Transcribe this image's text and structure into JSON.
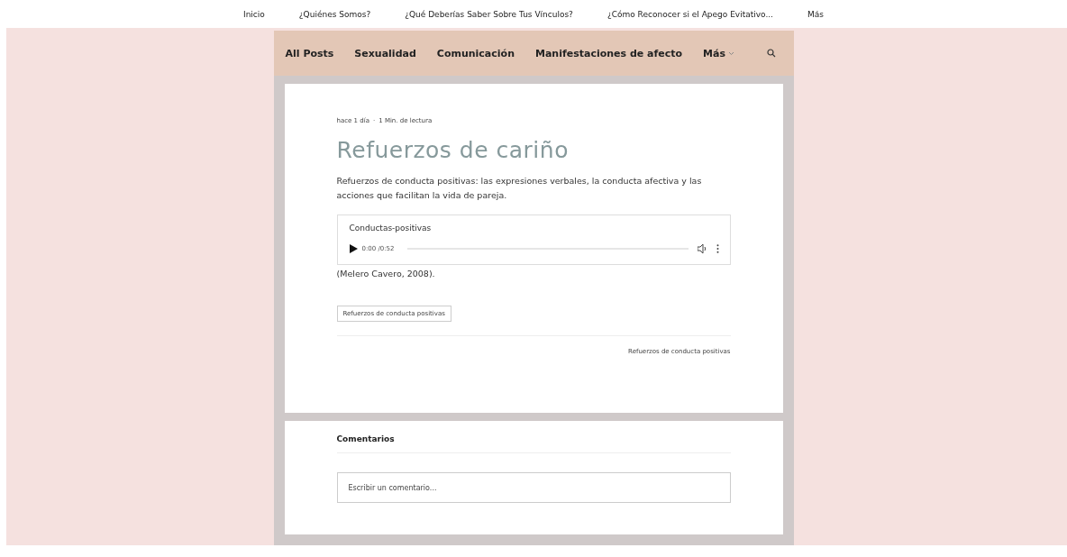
{
  "site_nav": [
    {
      "label": "Inicio"
    },
    {
      "label": "¿Quiénes Somos?"
    },
    {
      "label": "¿Qué Deberías Saber Sobre Tus Vínculos?"
    },
    {
      "label": "¿Cómo Reconocer si el Apego Evitativo..."
    },
    {
      "label": "Más"
    }
  ],
  "category_nav": {
    "items": [
      {
        "label": "All Posts",
        "kind": "link"
      },
      {
        "label": "Sexualidad",
        "kind": "link"
      },
      {
        "label": "Comunicación",
        "kind": "link"
      },
      {
        "label": "Manifestaciones de afecto",
        "kind": "link"
      },
      {
        "label": "Más",
        "kind": "dropdown"
      }
    ]
  },
  "post": {
    "date": "hace 1 día",
    "separator": "·",
    "read_time": "1 Min. de lectura",
    "title": "Refuerzos de cariño",
    "intro": "Refuerzos de conducta positivas: las expresiones verbales, la conducta afectiva y las acciones que facilitan la vida de pareja.",
    "audio": {
      "title": "Conductas-positivas",
      "time": "0:00 /0:52"
    },
    "citation": "(Melero Cavero, 2008).",
    "tags": [
      "Refuerzos de conducta positivas"
    ],
    "category_link": "Refuerzos de conducta positivas"
  },
  "comments": {
    "heading": "Comentarios",
    "placeholder": "Escribir un comentario..."
  }
}
